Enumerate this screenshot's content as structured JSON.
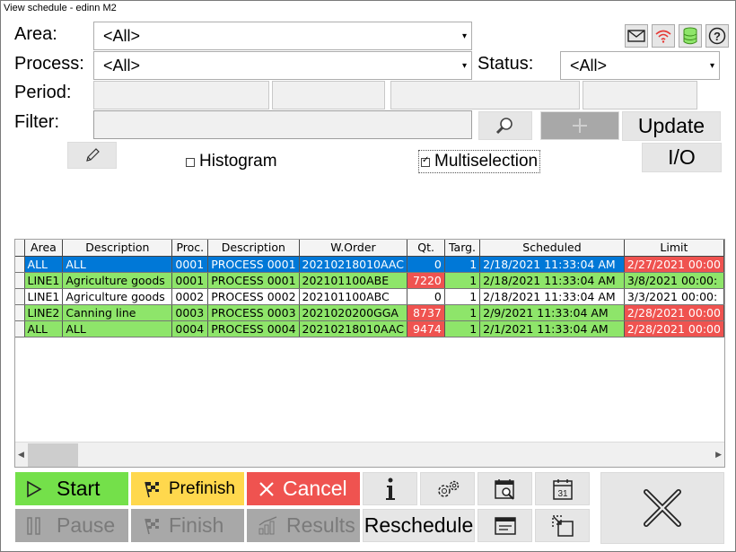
{
  "window": {
    "title": "View schedule - edinn M2"
  },
  "filters": {
    "area_label": "Area:",
    "area_value": "<All>",
    "process_label": "Process:",
    "process_value": "<All>",
    "status_label": "Status:",
    "status_value": "<All>",
    "period_label": "Period:",
    "filter_label": "Filter:",
    "filter_value": ""
  },
  "buttons": {
    "update": "Update",
    "io": "I/O",
    "histogram": "Histogram",
    "histogram_checked": false,
    "multiselection": "Multiselection",
    "multiselection_checked": true
  },
  "table": {
    "columns": [
      "Area",
      "Description",
      "Proc.",
      "Description",
      "W.Order",
      "Qt.",
      "Targ.",
      "Scheduled",
      "Limit"
    ],
    "rows": [
      {
        "area": "ALL",
        "desc": "ALL",
        "proc": "0001",
        "pdesc": "PROCESS 0001",
        "order": "20210218010AAC",
        "qt": "0",
        "targ": "1",
        "scheduled": "2/18/2021 11:33:04 AM",
        "limit": "2/27/2021 00:00",
        "row_color": "#0078d7",
        "text_color": "#ffffff",
        "qt_color": "",
        "limit_color": "#ef5350"
      },
      {
        "area": "LINE1",
        "desc": "Agriculture goods",
        "proc": "0001",
        "pdesc": "PROCESS 0001",
        "order": "202101100ABE",
        "qt": "7220",
        "targ": "1",
        "scheduled": "2/18/2021 11:33:04 AM",
        "limit": "3/8/2021 00:00:",
        "row_color": "#8ee56a",
        "text_color": "#000000",
        "qt_color": "#ef5350",
        "limit_color": ""
      },
      {
        "area": "LINE1",
        "desc": "Agriculture goods",
        "proc": "0002",
        "pdesc": "PROCESS 0002",
        "order": "202101100ABC",
        "qt": "0",
        "targ": "1",
        "scheduled": "2/18/2021 11:33:04 AM",
        "limit": "3/3/2021 00:00:",
        "row_color": "#ffffff",
        "text_color": "#000000",
        "qt_color": "",
        "limit_color": ""
      },
      {
        "area": "LINE2",
        "desc": "Canning line",
        "proc": "0003",
        "pdesc": "PROCESS 0003",
        "order": "2021020200GGA",
        "qt": "8737",
        "targ": "1",
        "scheduled": "2/9/2021 11:33:04 AM",
        "limit": "2/28/2021 00:00",
        "row_color": "#8ee56a",
        "text_color": "#000000",
        "qt_color": "#ef5350",
        "limit_color": "#ef5350"
      },
      {
        "area": "ALL",
        "desc": "ALL",
        "proc": "0004",
        "pdesc": "PROCESS 0004",
        "order": "20210218010AAC",
        "qt": "9474",
        "targ": "1",
        "scheduled": "2/1/2021 11:33:04 AM",
        "limit": "2/28/2021 00:00",
        "row_color": "#8ee56a",
        "text_color": "#000000",
        "qt_color": "#ef5350",
        "limit_color": "#ef5350"
      }
    ]
  },
  "actions": {
    "start": "Start",
    "prefinish": "Prefinish",
    "cancel": "Cancel",
    "pause": "Pause",
    "finish": "Finish",
    "results": "Results",
    "reschedule": "Reschedule",
    "calendar_day": "31"
  },
  "colors": {
    "start": "#74e04a",
    "prefinish": "#ffd84d",
    "cancel": "#ef5350",
    "disabled": "#a8a8a8",
    "selection": "#0078d7"
  },
  "icons": [
    "mail-icon",
    "wifi-icon",
    "database-icon",
    "help-icon",
    "edit-icon",
    "search-icon",
    "plus-icon",
    "play-icon",
    "checkered-flag-icon",
    "close-icon",
    "pause-icon",
    "chart-icon",
    "info-icon",
    "gears-icon",
    "schedule-search-icon",
    "calendar-icon",
    "card-icon",
    "resize-icon",
    "close-window-icon"
  ]
}
